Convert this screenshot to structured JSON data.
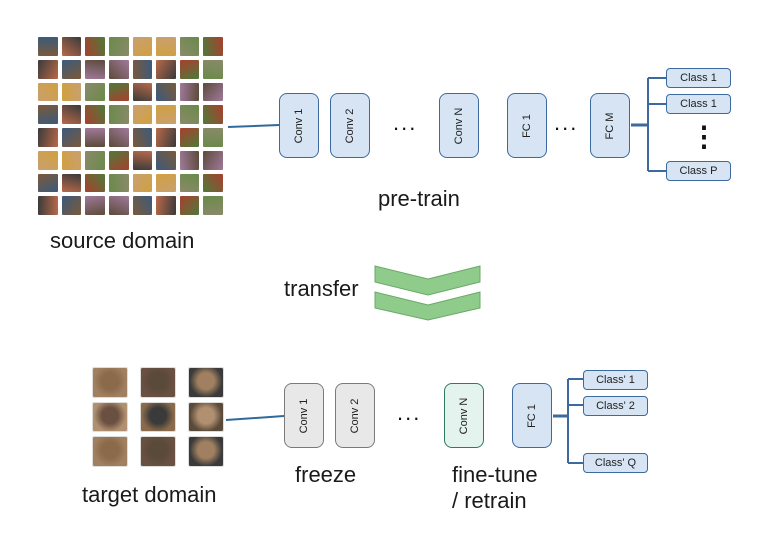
{
  "labels": {
    "source_domain": "source domain",
    "target_domain": "target domain",
    "pre_train": "pre-train",
    "transfer": "transfer",
    "freeze": "freeze",
    "fine_tune": "fine-tune",
    "retrain": "/ retrain"
  },
  "top_network": {
    "layers": [
      "Conv 1",
      "Conv 2",
      "Conv N",
      "FC 1",
      "FC M"
    ],
    "ellipsis": "...",
    "classes": [
      "Class 1",
      "Class 1",
      "Class P"
    ],
    "vertical_ellipsis": "⋮"
  },
  "bottom_network": {
    "layers": [
      "Conv 1",
      "Conv 2",
      "Conv N",
      "FC 1"
    ],
    "ellipsis": "...",
    "classes": [
      "Class' 1",
      "Class' 2",
      "Class' Q"
    ]
  },
  "colors": {
    "layer_fill": "#d6e4f3",
    "layer_border": "#3c6a9e",
    "freeze_fill": "#e8e8e8",
    "finetune_fill": "#e4f3ee",
    "arrow_green": "#8fcc8c",
    "connector": "#2f6a9a"
  }
}
